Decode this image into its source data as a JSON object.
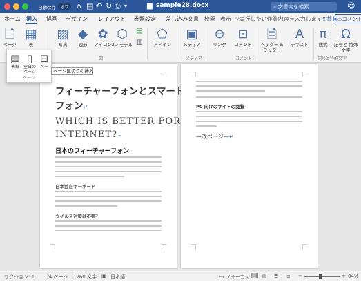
{
  "titlebar": {
    "autosave": "自動保存",
    "autosave_state": "オフ",
    "doc_title": "sample28.docx",
    "search_placeholder": "文書内を検索"
  },
  "tabs": [
    "ホーム",
    "挿入",
    "描画",
    "デザイン",
    "レイアウト",
    "参照設定",
    "差し込み文書",
    "校閲",
    "表示"
  ],
  "tellme": "実行したい作業内容を入力します",
  "share": "共有",
  "comment": "コメント",
  "ribbon": {
    "buttons": [
      "ページ",
      "表",
      "写真",
      "図形",
      "アイコン",
      "3D モデル",
      "アドイン",
      "メディア",
      "リンク",
      "コメント",
      "ヘッダー & フッター",
      "テキスト",
      "数式",
      "記号と 特殊文字"
    ],
    "groups": [
      "図",
      "メディア",
      "コメント",
      "記号と特殊文字"
    ]
  },
  "popup": {
    "buttons": [
      "表紙",
      "空白の ページ",
      "ペー"
    ],
    "group": "ページ"
  },
  "tooltip": "ページ区切りの挿入",
  "page1": {
    "title_line1": "フィーチャーフォンとスマート",
    "title_line2": "フォン",
    "subtitle_line1": "WHICH IS BETTER FOR",
    "subtitle_line2": "INTERNET?",
    "heading": "日本のフィーチャーフォン",
    "sub1": "日本独自キーボード",
    "sub2": "ウイルス対策は不要？"
  },
  "page2": {
    "heading": "PC 向けのサイトの閲覧",
    "pagebreak": "改ページ"
  },
  "status": {
    "section": "セクション: 1",
    "page": "1/4 ページ",
    "words": "1260 文字",
    "lang": "日本語",
    "focus": "フォーカス",
    "zoom": "64%"
  }
}
